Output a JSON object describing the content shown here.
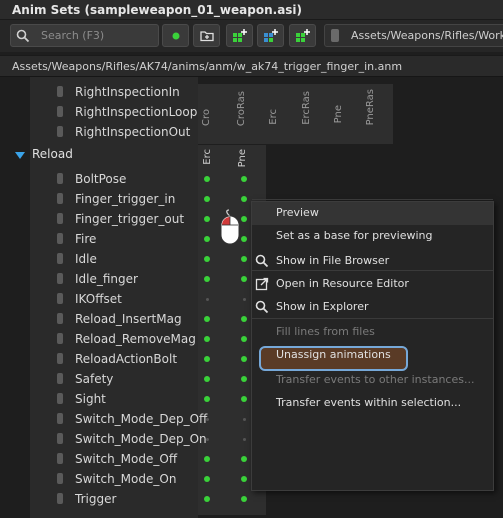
{
  "window": {
    "title": "Anim Sets (sampleweapon_01_weapon.asi)"
  },
  "toolbar": {
    "search_placeholder": "Search (F3)",
    "status_color": "#3ad23a",
    "path": "Assets/Weapons/Rifles/Works"
  },
  "filepath": "Assets/Weapons/Rifles/AK74/anims/anm/w_ak74_trigger_finger_in.anm",
  "columns_top": [
    "Cro",
    "CroRas",
    "Erc",
    "ErcRas",
    "Pne",
    "PneRas"
  ],
  "columns_group": [
    "Erc",
    "Pne"
  ],
  "prev_rows": [
    {
      "label": "RightInspectionIn"
    },
    {
      "label": "RightInspectionLoop"
    },
    {
      "label": "RightInspectionOut"
    }
  ],
  "group": {
    "label": "Reload",
    "expanded": true
  },
  "rows": [
    {
      "label": "BoltPose",
      "erc": true,
      "pne": true
    },
    {
      "label": "Finger_trigger_in",
      "erc": true,
      "pne": true
    },
    {
      "label": "Finger_trigger_out",
      "erc": true,
      "pne": true
    },
    {
      "label": "Fire",
      "erc": true,
      "pne": true
    },
    {
      "label": "Idle",
      "erc": true,
      "pne": true
    },
    {
      "label": "Idle_finger",
      "erc": true,
      "pne": true
    },
    {
      "label": "IKOffset",
      "erc": false,
      "pne": false
    },
    {
      "label": "Reload_InsertMag",
      "erc": true,
      "pne": true
    },
    {
      "label": "Reload_RemoveMag",
      "erc": true,
      "pne": true
    },
    {
      "label": "ReloadActionBolt",
      "erc": true,
      "pne": true
    },
    {
      "label": "Safety",
      "erc": true,
      "pne": true
    },
    {
      "label": "Sight",
      "erc": true,
      "pne": true
    },
    {
      "label": "Switch_Mode_Dep_Off",
      "erc": false,
      "pne": false
    },
    {
      "label": "Switch_Mode_Dep_On",
      "erc": false,
      "pne": false
    },
    {
      "label": "Switch_Mode_Off",
      "erc": true,
      "pne": true
    },
    {
      "label": "Switch_Mode_On",
      "erc": true,
      "pne": true
    },
    {
      "label": "Trigger",
      "erc": true,
      "pne": true
    }
  ],
  "context_menu": {
    "items": [
      {
        "label": "Preview",
        "icon": "",
        "disabled": false,
        "hovered": true
      },
      {
        "label": "Set as a base for previewing",
        "icon": "",
        "disabled": false
      },
      {
        "label": "Show in File Browser",
        "icon": "search-icon",
        "disabled": false
      },
      {
        "label": "Open in Resource Editor",
        "icon": "external-link-icon",
        "disabled": false
      },
      {
        "label": "Show in Explorer",
        "icon": "search-icon",
        "disabled": false
      },
      {
        "label": "Fill lines from files",
        "icon": "",
        "disabled": true
      },
      {
        "label": "Unassign animations",
        "icon": "",
        "disabled": false,
        "highlighted": true
      },
      {
        "label": "Transfer events to other instances...",
        "icon": "",
        "disabled": true
      },
      {
        "label": "Transfer events within selection...",
        "icon": "",
        "disabled": false
      }
    ]
  }
}
